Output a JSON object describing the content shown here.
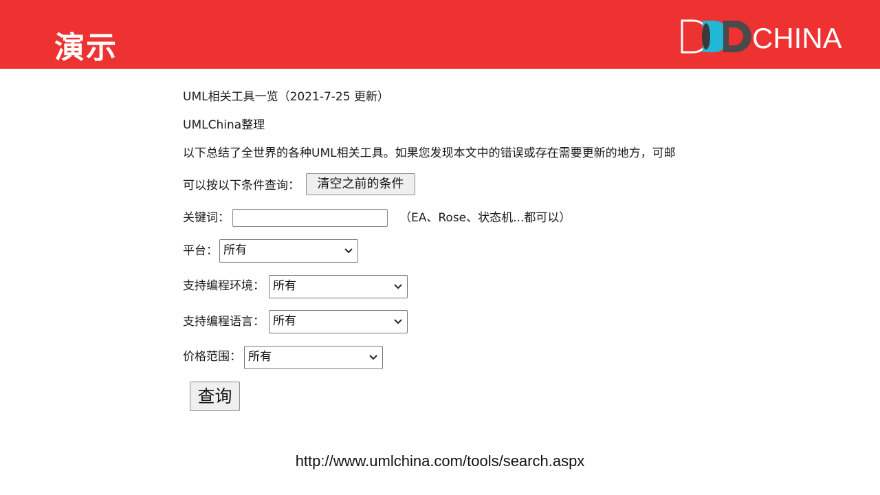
{
  "slide": {
    "title": "演示",
    "logo": {
      "icon": "ddd-logo-icon",
      "text": "CHINA"
    },
    "url": "http://www.umlchina.com/tools/search.aspx"
  },
  "page": {
    "heading": "UML相关工具一览（2021-7-25 更新）",
    "author": "UMLChina整理",
    "intro": "以下总结了全世界的各种UML相关工具。如果您发现本文中的错误或存在需要更新的地方，可邮",
    "query_prompt": "可以按以下条件查询：",
    "clear_button": "清空之前的条件",
    "keyword": {
      "label": "关键词：",
      "value": "",
      "placeholder": "",
      "hint": "（EA、Rose、状态机...都可以）"
    },
    "filters": [
      {
        "label": "平台：",
        "value": "所有"
      },
      {
        "label": "支持编程环境：",
        "value": "所有"
      },
      {
        "label": "支持编程语言：",
        "value": "所有"
      },
      {
        "label": "价格范围：",
        "value": "所有"
      }
    ],
    "submit_button": "查询"
  },
  "colors": {
    "header_red": "#ee3131",
    "logo_cyan": "#1fb8d6",
    "logo_dark": "#4a4a4a"
  }
}
